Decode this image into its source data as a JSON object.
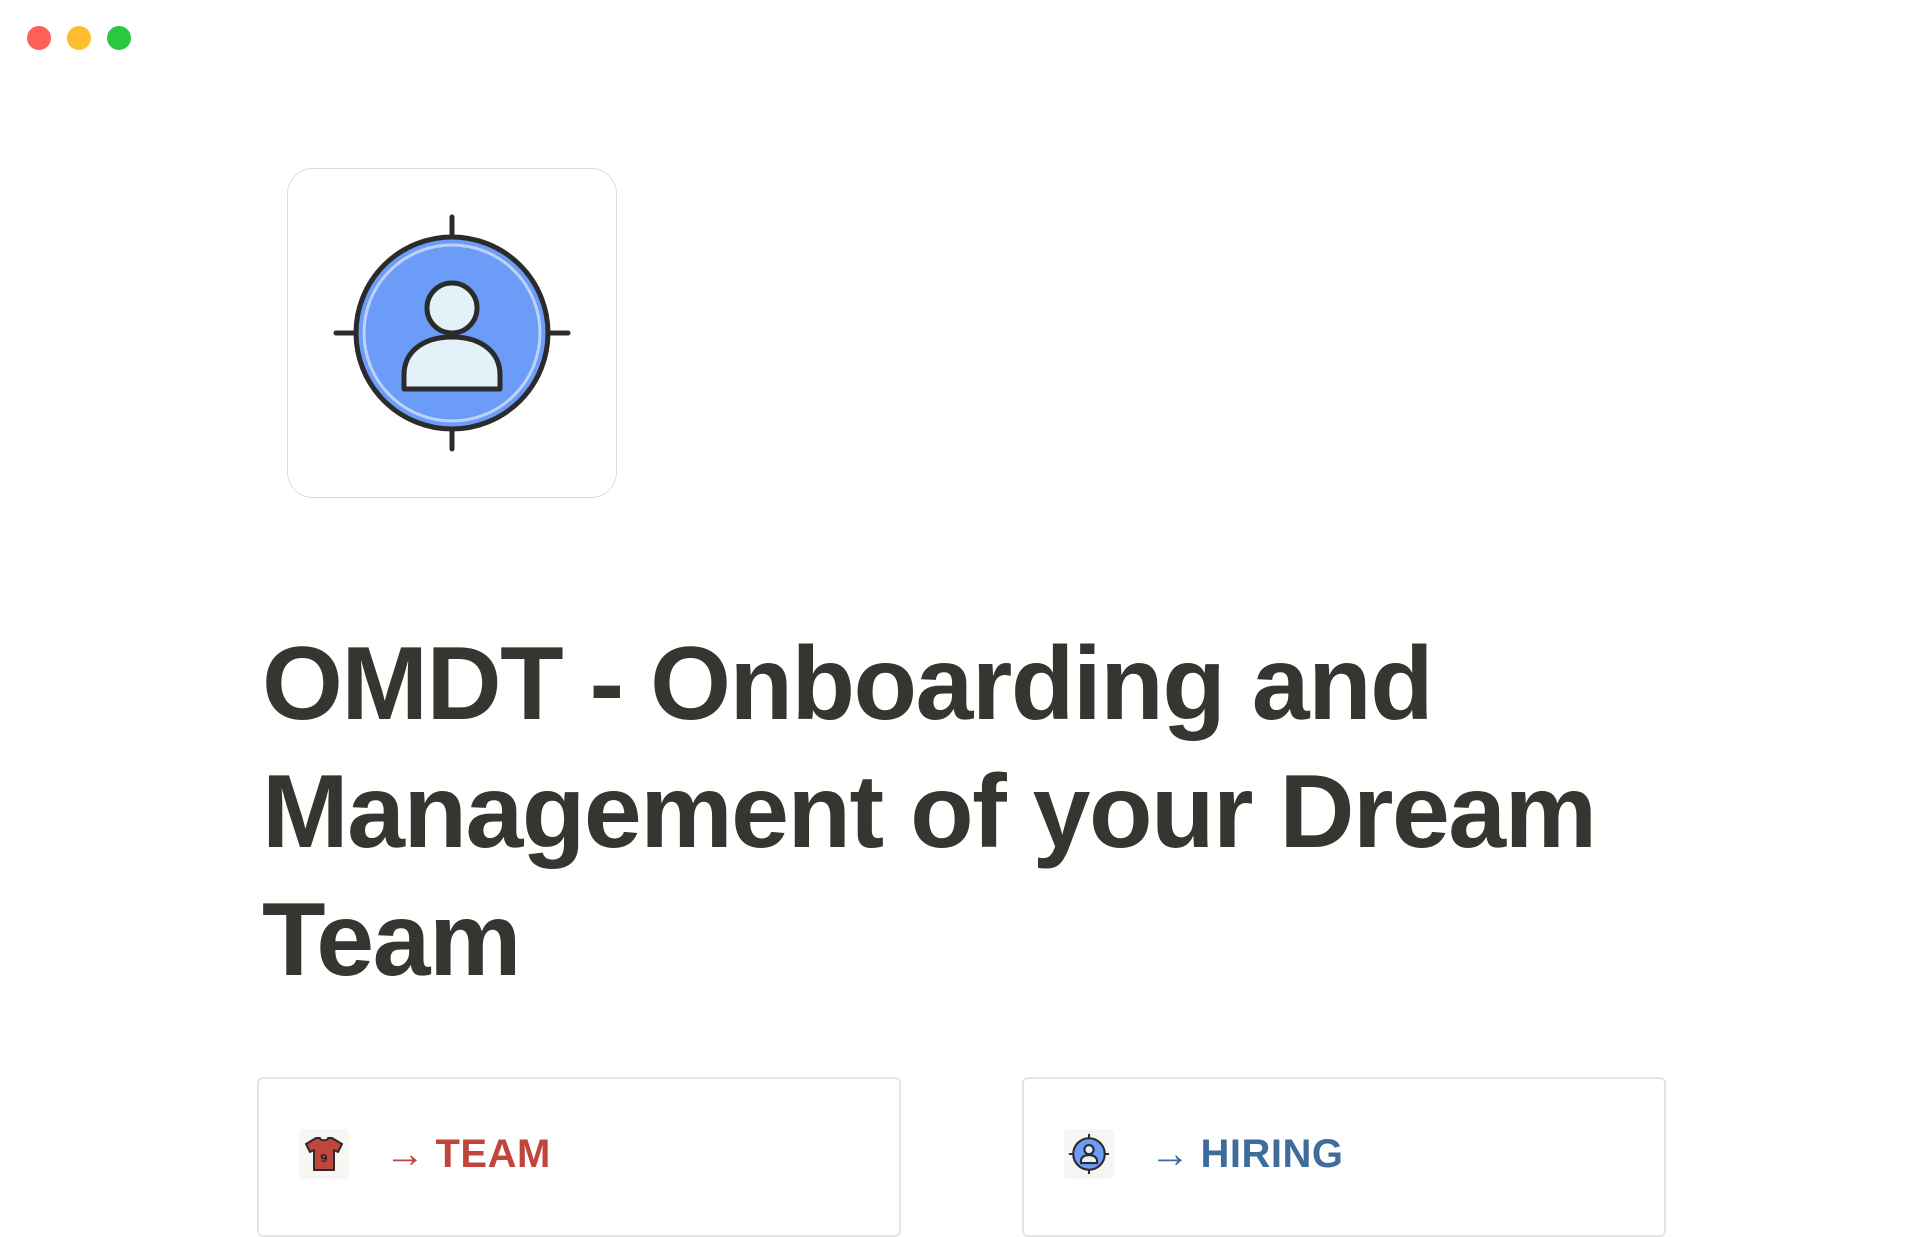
{
  "window": {
    "controls": [
      "close",
      "minimize",
      "zoom"
    ]
  },
  "page": {
    "icon": "target-person-icon",
    "title": "OMDT - Onboarding and Management of your Dream Team"
  },
  "links": [
    {
      "arrow": "→",
      "label": "TEAM",
      "icon": "jersey-icon",
      "color": "#c0453a"
    },
    {
      "arrow": "→",
      "label": "HIRING",
      "icon": "target-person-icon",
      "color": "#3e6d9c"
    }
  ],
  "colors": {
    "text": "#37352f",
    "icon_blue": "#6b9cf7",
    "icon_person": "#e3f2f8",
    "team_red": "#c0453a",
    "hiring_blue": "#3e6d9c"
  }
}
